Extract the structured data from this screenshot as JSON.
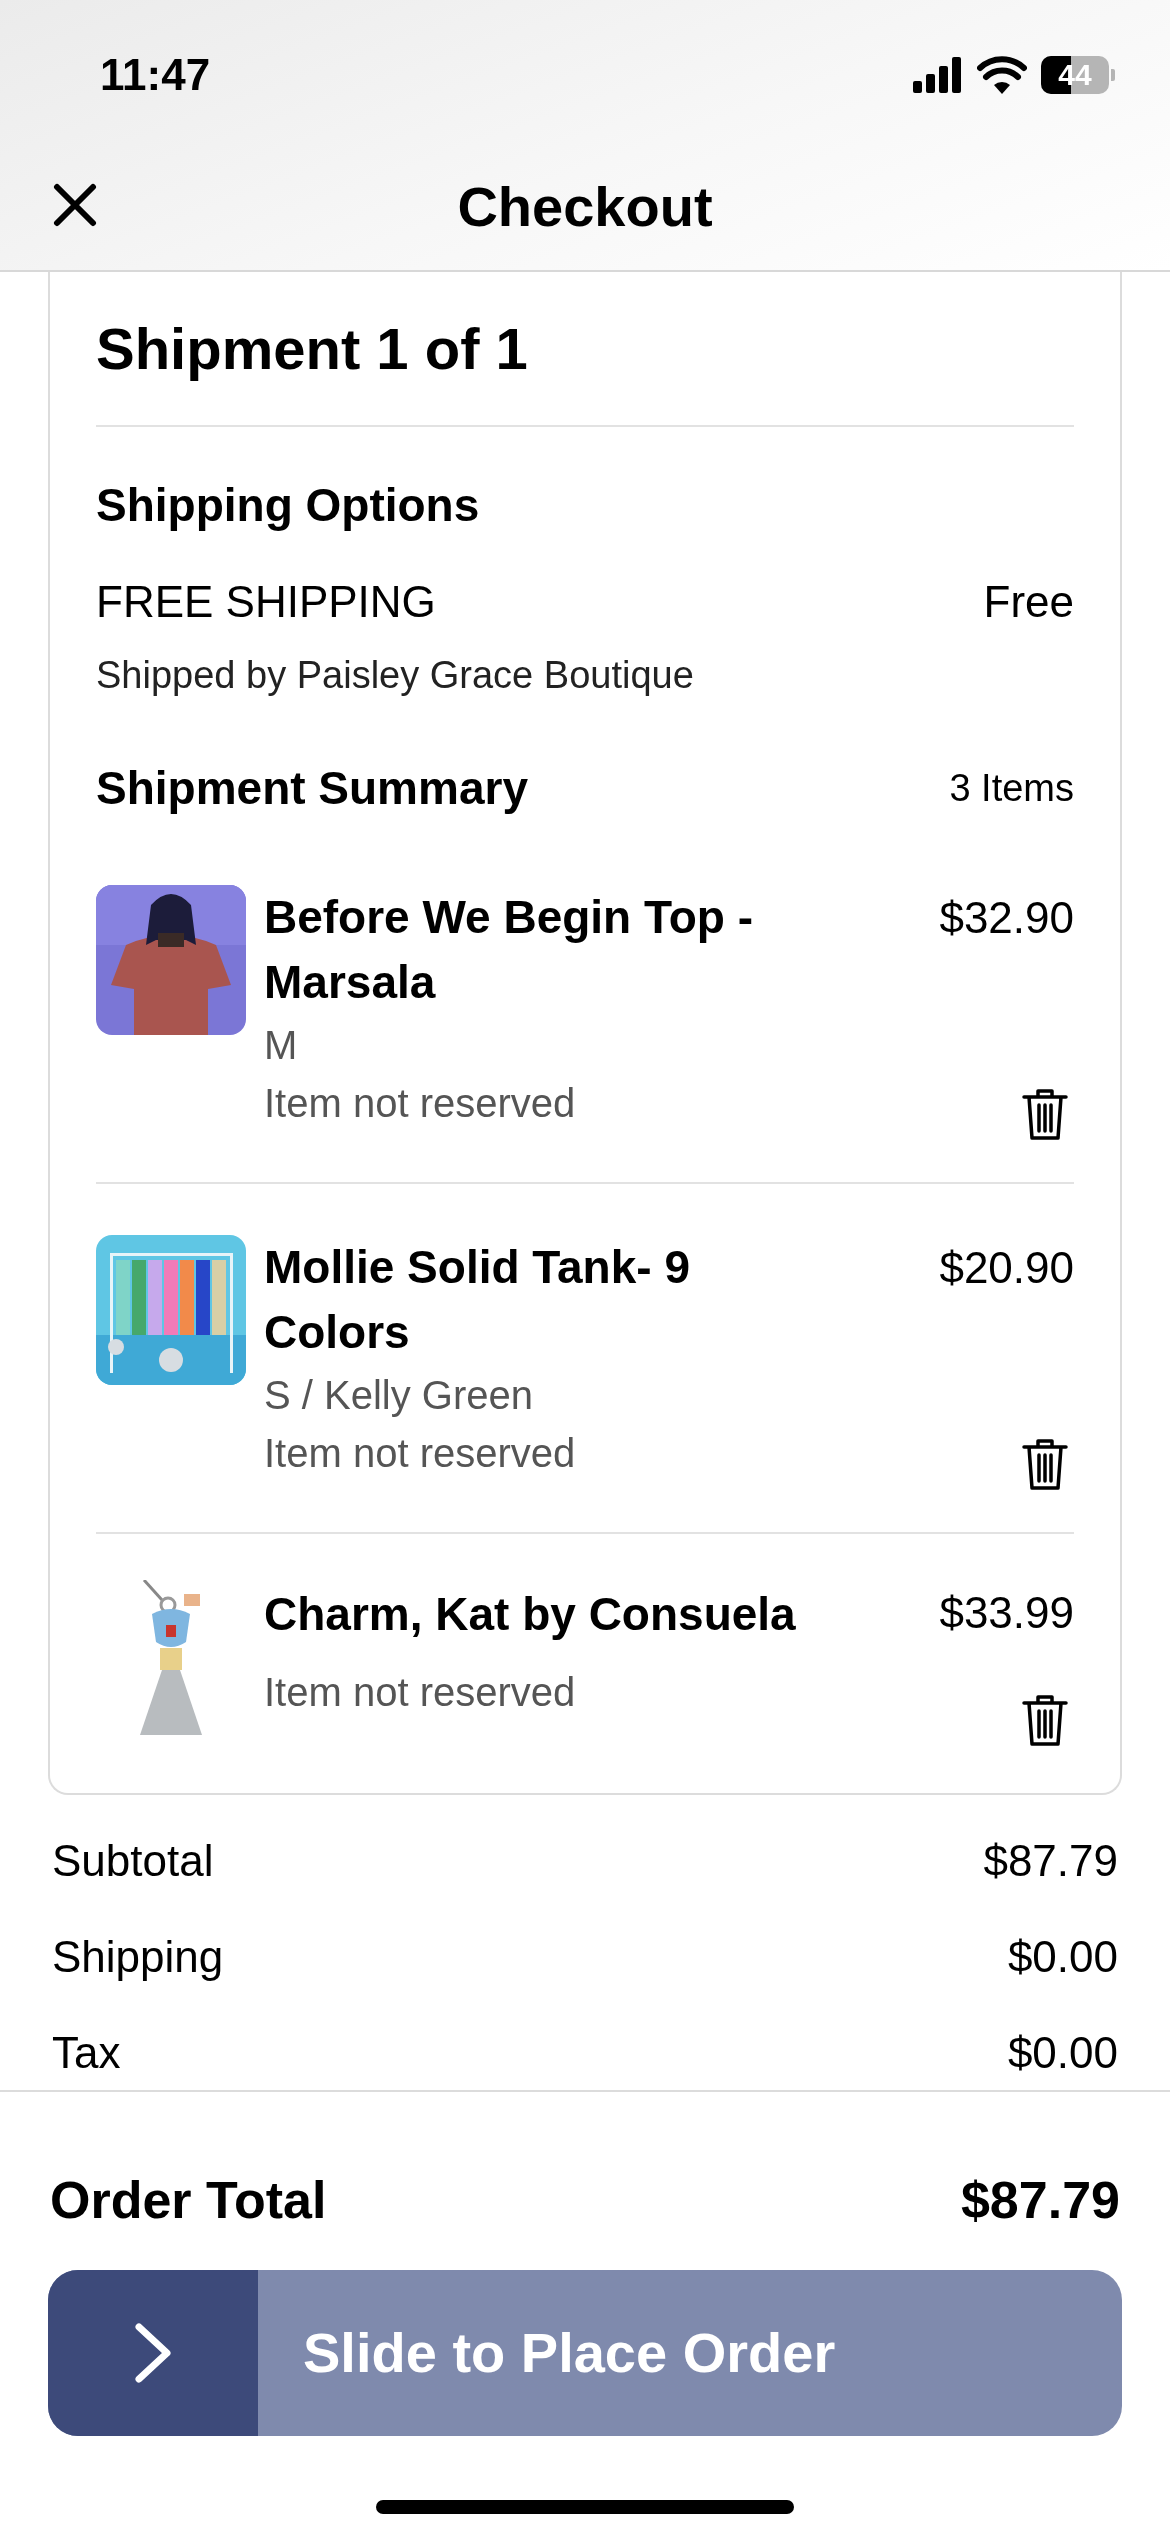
{
  "status_bar": {
    "time": "11:47",
    "battery": "44"
  },
  "header": {
    "title": "Checkout"
  },
  "shipment": {
    "title": "Shipment 1 of 1",
    "shipping_options_heading": "Shipping Options",
    "shipping_option": {
      "name": "FREE SHIPPING",
      "price": "Free",
      "shipped_by": "Shipped by Paisley Grace Boutique"
    },
    "summary_heading": "Shipment Summary",
    "item_count": "3 Items",
    "items": [
      {
        "name": "Before We Begin Top - Marsala",
        "price": "$32.90",
        "variant": "M",
        "reservation": "Item not reserved"
      },
      {
        "name": "Mollie Solid Tank- 9 Colors",
        "price": "$20.90",
        "variant": "S / Kelly Green",
        "reservation": "Item not reserved"
      },
      {
        "name": "Charm, Kat by Consuela",
        "price": "$33.99",
        "reservation": "Item not reserved"
      }
    ]
  },
  "totals": [
    {
      "label": "Subtotal",
      "value": "$87.79"
    },
    {
      "label": "Shipping",
      "value": "$0.00"
    },
    {
      "label": "Tax",
      "value": "$0.00"
    }
  ],
  "order_total": {
    "label": "Order Total",
    "value": "$87.79"
  },
  "slider": {
    "label": "Slide to Place Order",
    "level": 0
  }
}
